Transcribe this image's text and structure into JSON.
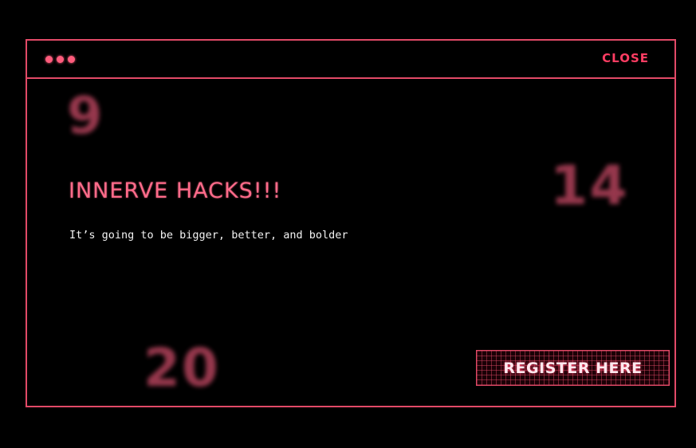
{
  "window": {
    "close_label": "CLOSE"
  },
  "decor": {
    "numbers": [
      "9",
      "14",
      "20"
    ]
  },
  "content": {
    "headline": "INNERVE HACKS!!!",
    "tagline": "It’s going to be bigger, better, and bolder",
    "register_label": "REGISTER HERE"
  },
  "colors": {
    "accent": "#e24a67",
    "headline": "#ff6b8a",
    "close": "#ff3d63",
    "background": "#000000"
  }
}
